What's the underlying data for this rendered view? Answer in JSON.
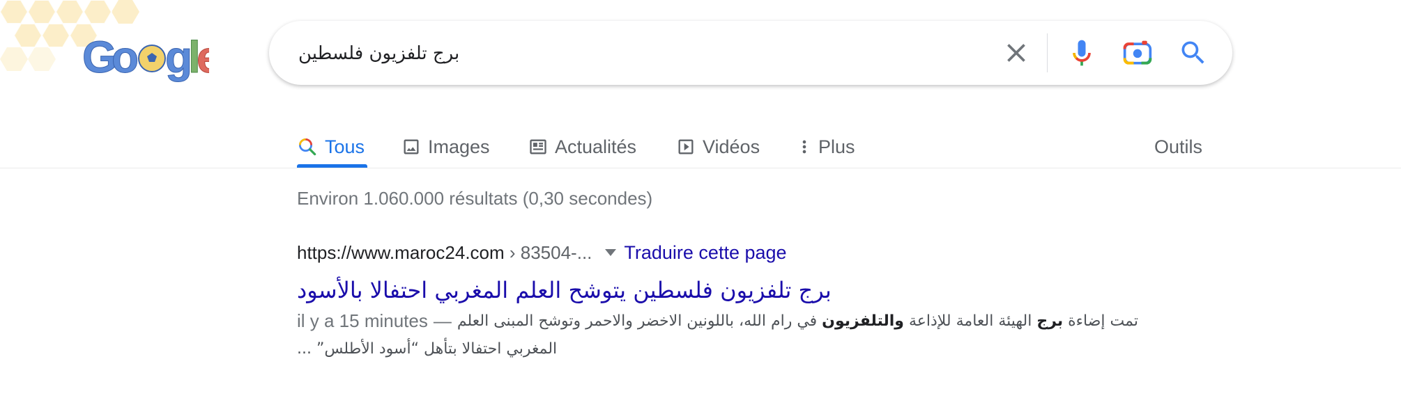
{
  "logo": {
    "alt": "Google"
  },
  "search": {
    "query": "برج تلفزيون فلسطين",
    "clear_icon": "close-icon",
    "voice_icon": "microphone-icon",
    "lens_icon": "camera-lens-icon",
    "search_icon": "search-icon"
  },
  "tabs": [
    {
      "label": "Tous",
      "icon": "search-icon",
      "active": true
    },
    {
      "label": "Images",
      "icon": "image-icon"
    },
    {
      "label": "Actualités",
      "icon": "news-icon"
    },
    {
      "label": "Vidéos",
      "icon": "play-icon"
    },
    {
      "label": "Plus",
      "icon": "more-vert-icon"
    }
  ],
  "tools_label": "Outils",
  "stats": "Environ 1.060.000 résultats (0,30 secondes)",
  "result": {
    "url_host": "https://www.maroc24.com",
    "url_path": " › 83504-...",
    "translate_label": "Traduire cette page",
    "title": "برج تلفزيون فلسطين يتوشح العلم المغربي احتفالا بالأسود",
    "date": "il y a 15 minutes",
    "dash": "—",
    "snippet_part1": "تمت إضاءة ",
    "snippet_bold1": "برج",
    "snippet_part2": " الهيئة العامة للإذاعة ",
    "snippet_bold2": "والتلفزيون",
    "snippet_part3": " في رام الله، باللونين الاخضر والاحمر وتوشح المبنى العلم",
    "snippet_line2": "المغربي احتفالا بتأهل “أسود الأطلس” ..."
  },
  "colors": {
    "link": "#1a0dab",
    "active_tab": "#1a73e8",
    "muted": "#70757a"
  }
}
